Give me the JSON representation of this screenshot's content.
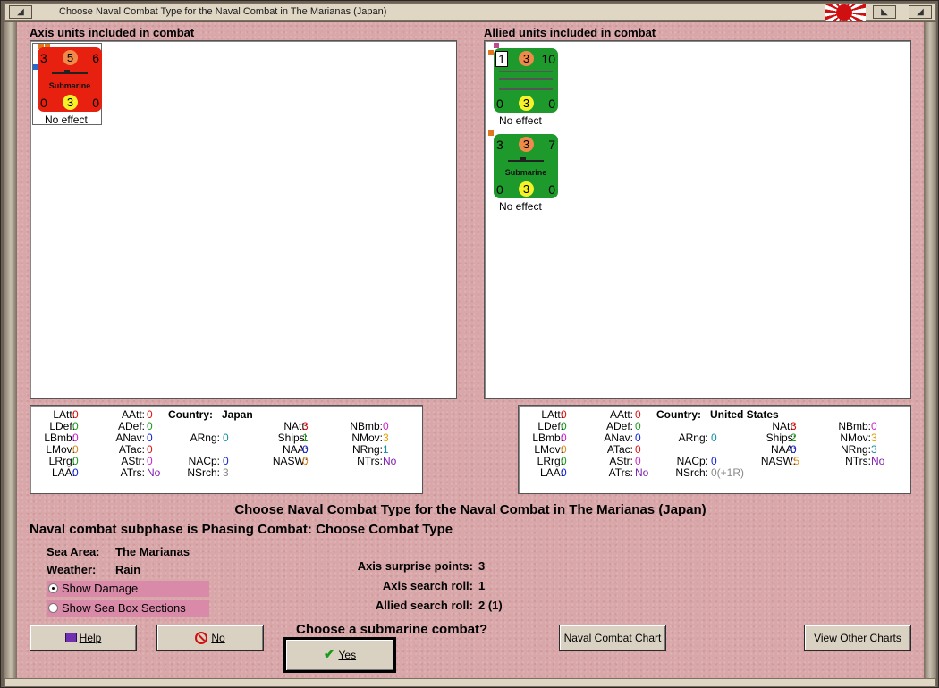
{
  "window": {
    "title": "Choose Naval Combat Type for the Naval Combat in The Marianas (Japan)"
  },
  "axis": {
    "heading": "Axis units included in combat",
    "units": [
      {
        "top_left": "3",
        "top_mid": "5",
        "top_right": "6",
        "name": "Submarine",
        "bot_left": "0",
        "bot_mid": "3",
        "bot_right": "0",
        "effect": "No effect"
      }
    ],
    "stats": {
      "latt": "0",
      "ldef": "0",
      "lbmb": "0",
      "lmov": "0",
      "lrng": "0",
      "laa": "0",
      "aatt": "0",
      "adef": "0",
      "anav": "0",
      "atac": "0",
      "astr": "0",
      "atrs": "No",
      "arng": "0",
      "nacp": "0",
      "nsrch": "3",
      "country_label": "Country:",
      "country": "Japan",
      "natt": "3",
      "ships": "1",
      "naa": "0",
      "nasw": "0",
      "nbmb": "0",
      "nmov": "3",
      "nrng": "1",
      "ntrs": "No"
    }
  },
  "allied": {
    "heading": "Allied units included in combat",
    "units": [
      {
        "top_left": "1",
        "top_mid": "3",
        "top_right": "10",
        "name": "",
        "bot_left": "0",
        "bot_mid": "3",
        "bot_right": "0",
        "effect": "No effect"
      },
      {
        "top_left": "3",
        "top_mid": "3",
        "top_right": "7",
        "name": "Submarine",
        "bot_left": "0",
        "bot_mid": "3",
        "bot_right": "0",
        "effect": "No effect"
      }
    ],
    "stats": {
      "latt": "0",
      "ldef": "0",
      "lbmb": "0",
      "lmov": "0",
      "lrng": "0",
      "laa": "0",
      "aatt": "0",
      "adef": "0",
      "anav": "0",
      "atac": "0",
      "astr": "0",
      "atrs": "No",
      "arng": "0",
      "nacp": "0",
      "nsrch": "0(+1R)",
      "country_label": "Country:",
      "country": "United States",
      "natt": "3",
      "ships": "2",
      "naa": "0",
      "nasw": ".5",
      "nbmb": "0",
      "nmov": "3",
      "nrng": "3",
      "ntrs": "No"
    }
  },
  "labels": {
    "latt": "LAtt:",
    "ldef": "LDef:",
    "lbmb": "LBmb:",
    "lmov": "LMov:",
    "lrng": "LRrg:",
    "laa": "LAA:",
    "aatt": "AAtt:",
    "adef": "ADef:",
    "anav": "ANav:",
    "atac": "ATac:",
    "astr": "AStr:",
    "atrs": "ATrs:",
    "arng": "ARng:",
    "nacp": "NACp:",
    "nsrch": "NSrch:",
    "natt": "NAtt:",
    "ships": "Ships:",
    "naa": "NAA:",
    "nasw": "NASW:",
    "nbmb": "NBmb:",
    "nmov": "NMov:",
    "nrng": "NRng:",
    "ntrs": "NTrs:"
  },
  "main": {
    "heading": "Choose Naval Combat Type for the Naval Combat in The Marianas (Japan)",
    "subphase": "Naval combat subphase is Phasing Combat: Choose Combat Type",
    "sea_area_label": "Sea Area:",
    "sea_area": "The Marianas",
    "weather_label": "Weather:",
    "weather": "Rain",
    "show_damage": "Show Damage",
    "show_sea_box": "Show Sea Box Sections",
    "surprise_label": "Axis surprise points:",
    "surprise": "3",
    "axis_search_label": "Axis search roll:",
    "axis_search": "1",
    "allied_search_label": "Allied search roll:",
    "allied_search": "2 (1)",
    "question": "Choose a submarine combat?"
  },
  "buttons": {
    "help": "Help",
    "no": "No",
    "yes": "Yes",
    "naval_chart": "Naval Combat Chart",
    "other_charts": "View Other Charts"
  },
  "colors": {
    "background": "#d9a7a9",
    "axis_counter": "#e82010",
    "allied_counter": "#1e9a2c"
  }
}
